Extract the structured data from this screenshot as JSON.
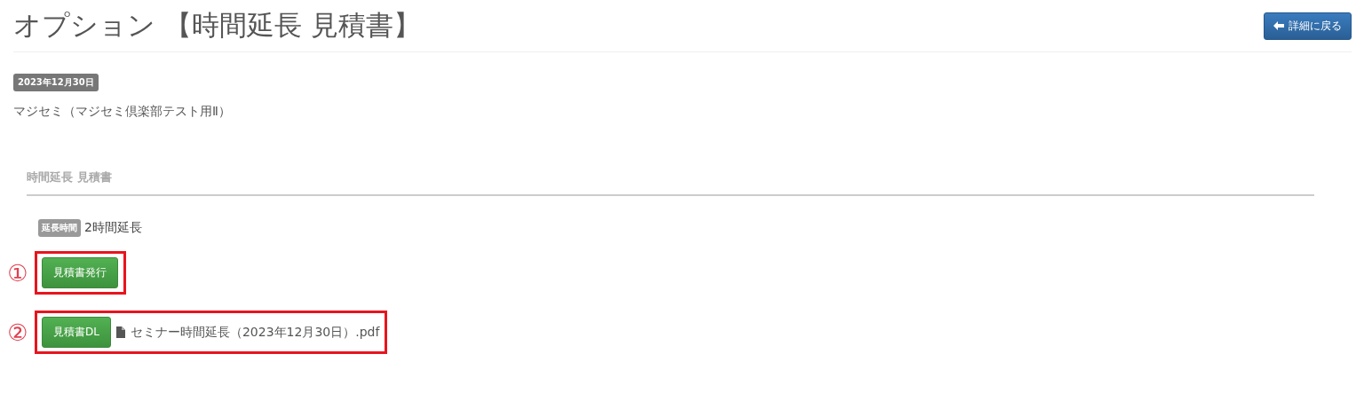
{
  "page_title": "オプション 【時間延長 見積書】",
  "back_button": {
    "label": "詳細に戻る"
  },
  "date_badge": "2023年12月30日",
  "seminar_name": "マジセミ（マジセミ倶楽部テスト用Ⅱ）",
  "section": {
    "heading": "時間延長 見積書",
    "fields": [
      {
        "label": "延長時間",
        "value": "2時間延長"
      }
    ],
    "steps": [
      {
        "marker": "①",
        "kind": "issue",
        "button": "見積書発行"
      },
      {
        "marker": "②",
        "kind": "download",
        "button": "見積書DL",
        "file": "セミナー時間延長（2023年12月30日）.pdf"
      }
    ]
  }
}
